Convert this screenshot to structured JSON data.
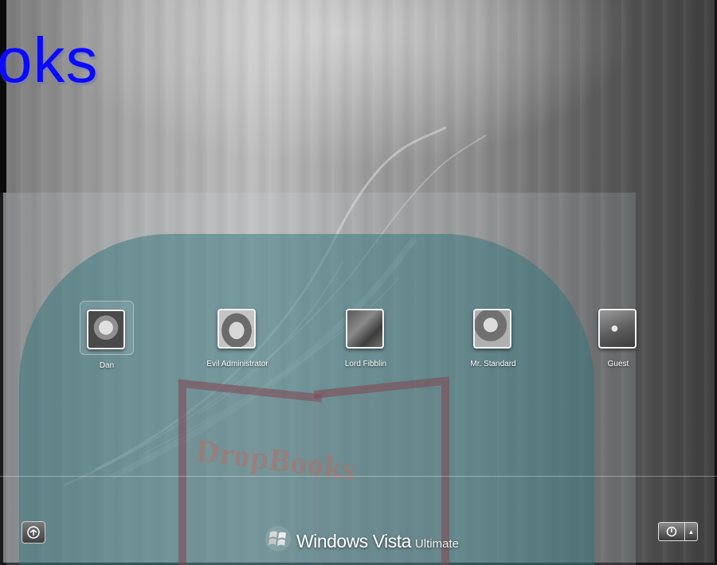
{
  "watermark": {
    "text": "oks",
    "colors": {
      "text": "#0a0aff",
      "panel_teal": "#2e737c"
    }
  },
  "users": [
    {
      "name": "Dan",
      "selected": true,
      "icon": "dan-photo"
    },
    {
      "name": "Evil Administrator",
      "selected": false,
      "icon": "evil-administrator-photo"
    },
    {
      "name": "Lord Fibblin",
      "selected": false,
      "icon": "lord-fibblin-photo"
    },
    {
      "name": "Mr. Standard",
      "selected": false,
      "icon": "mr-standard-photo"
    },
    {
      "name": "Guest",
      "selected": false,
      "icon": "guest-briefcase"
    }
  ],
  "branding": {
    "windows": "Windows Vista",
    "edition": "Ultimate",
    "icon": "windows-flag-icon"
  },
  "controls": {
    "ease_of_access_icon": "ease-of-access-icon",
    "power_icon": "power-icon",
    "power_menu_icon": "arrow-up-icon"
  }
}
